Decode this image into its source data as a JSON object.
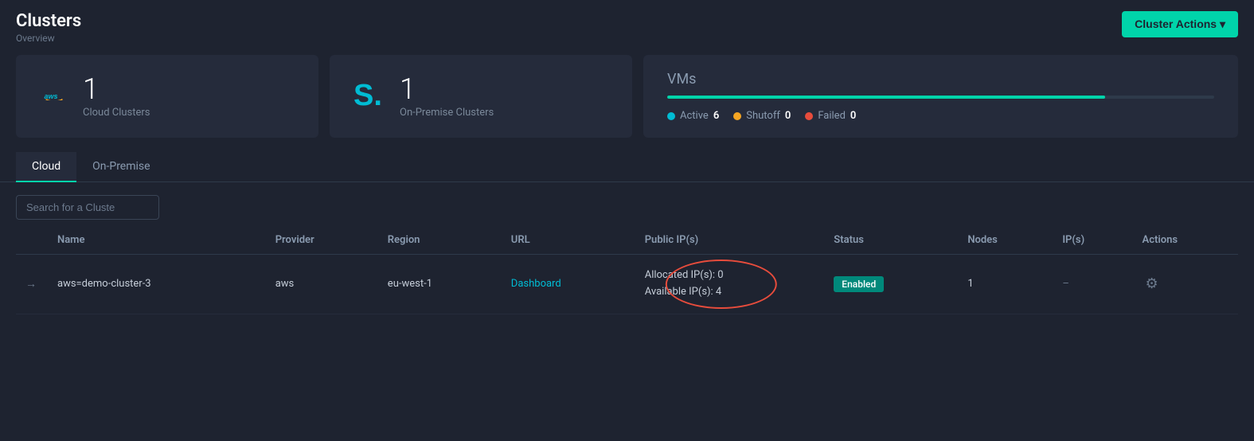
{
  "page": {
    "title": "Clusters",
    "breadcrumb": "Overview"
  },
  "header": {
    "cluster_actions_label": "Cluster Actions ▾"
  },
  "stats": {
    "cloud": {
      "count": "1",
      "label": "Cloud Clusters"
    },
    "onpremise": {
      "count": "1",
      "label": "On-Premise Clusters"
    },
    "vms": {
      "title": "VMs",
      "progress_pct": 80,
      "active_label": "Active",
      "active_count": "6",
      "shutoff_label": "Shutoff",
      "shutoff_count": "0",
      "failed_label": "Failed",
      "failed_count": "0"
    }
  },
  "tabs": [
    {
      "id": "cloud",
      "label": "Cloud",
      "active": true
    },
    {
      "id": "onpremise",
      "label": "On-Premise",
      "active": false
    }
  ],
  "search": {
    "placeholder": "Search for a Cluste"
  },
  "table": {
    "columns": [
      "",
      "Name",
      "Provider",
      "Region",
      "URL",
      "Public IP(s)",
      "Status",
      "Nodes",
      "IP(s)",
      "Actions"
    ],
    "rows": [
      {
        "arrow": "→",
        "name": "aws=demo-cluster-3",
        "provider": "aws",
        "region": "eu-west-1",
        "url": "Dashboard",
        "public_ip_line1": "Allocated IP(s): 0",
        "public_ip_line2": "Available IP(s): 4",
        "status": "Enabled",
        "nodes": "1",
        "ips": "–",
        "actions": "⚙"
      }
    ]
  }
}
